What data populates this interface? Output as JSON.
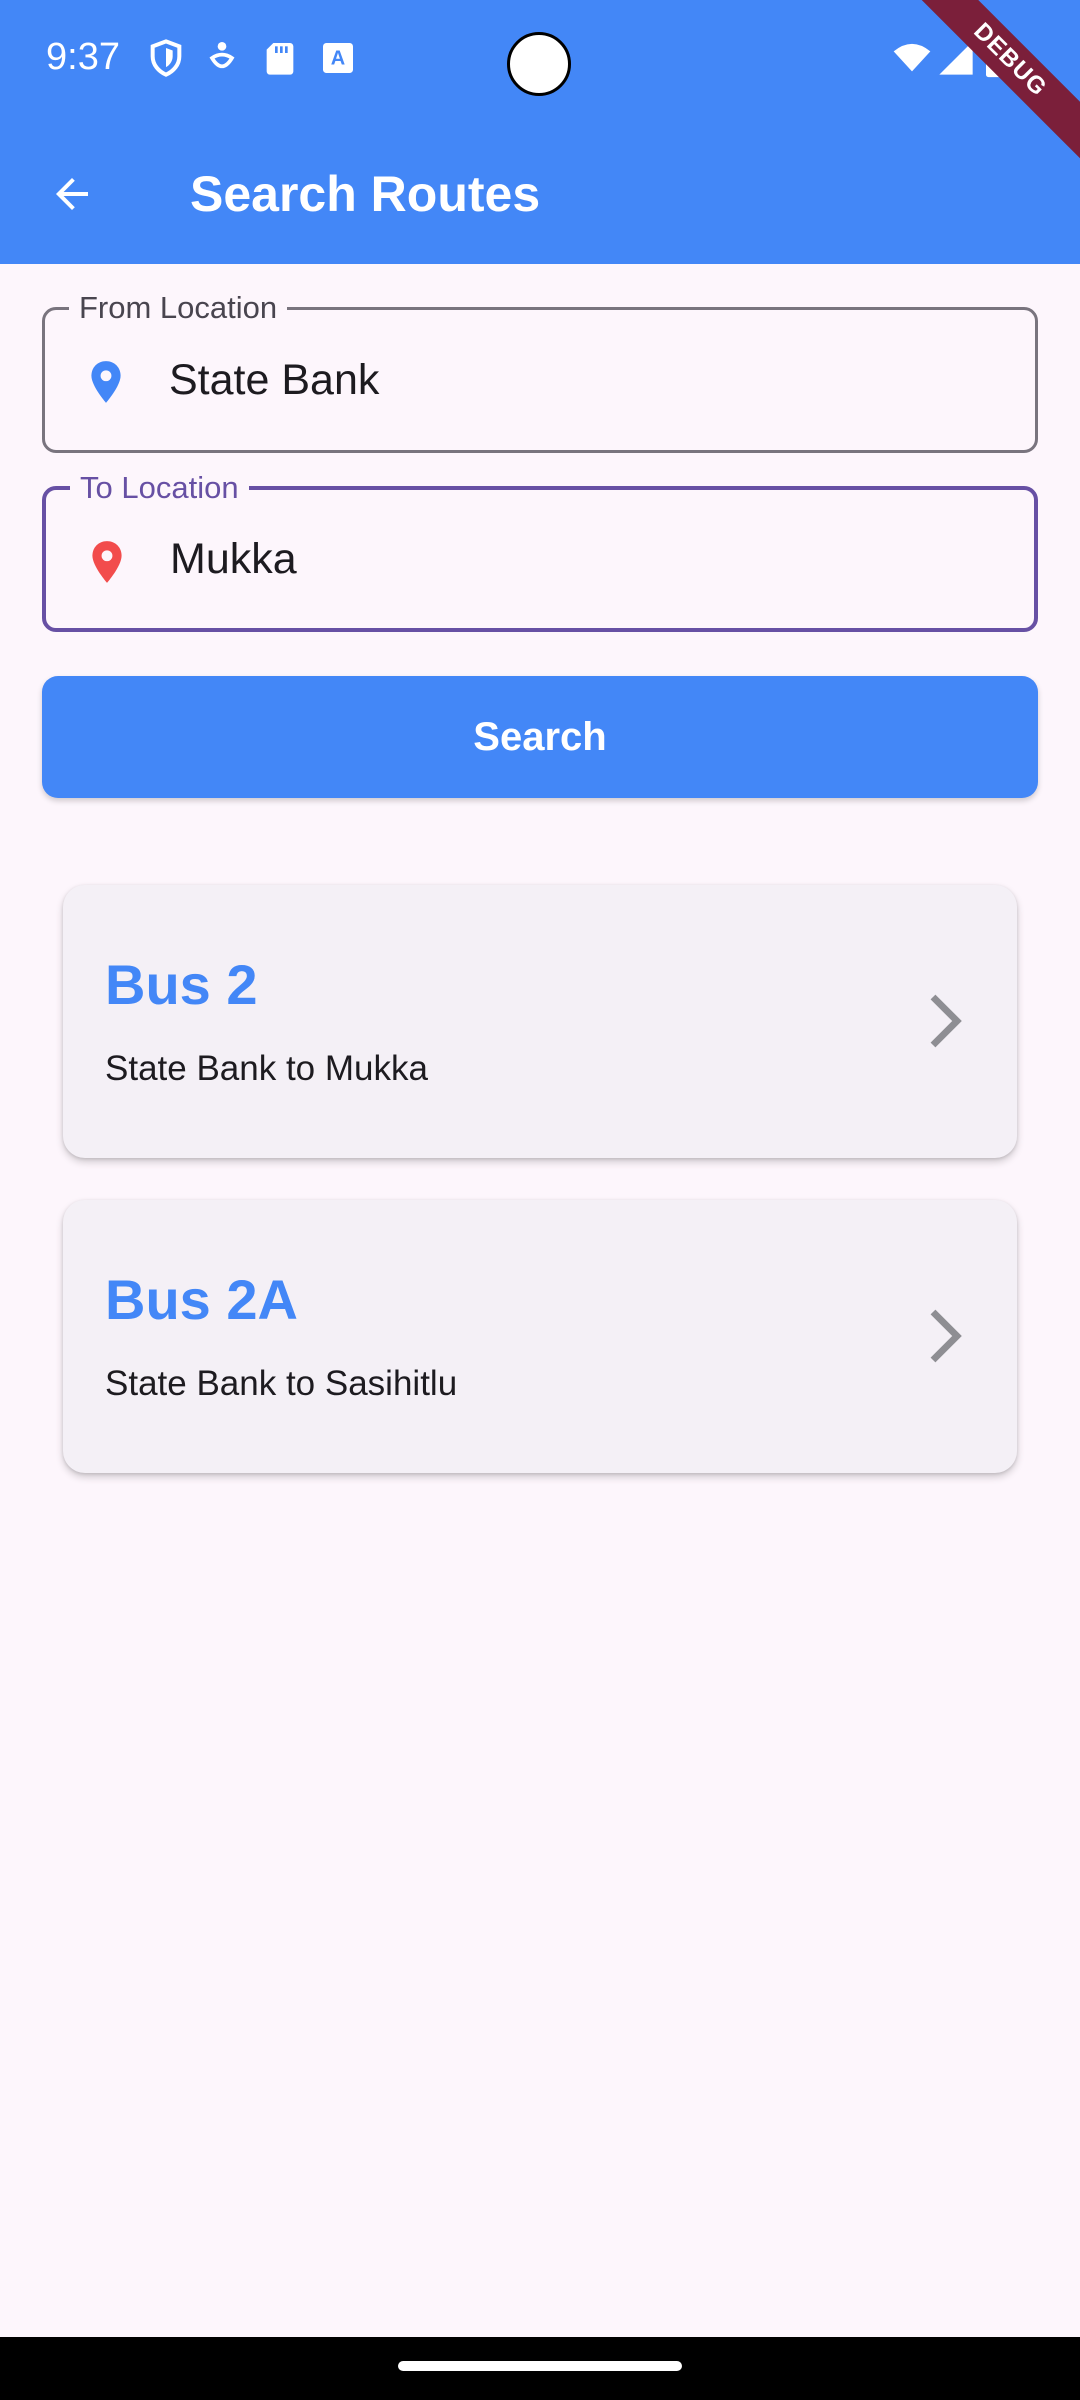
{
  "status_bar": {
    "time": "9:37",
    "icons": [
      "shield-icon",
      "accessibility-icon",
      "sd-card-icon",
      "keyboard-a-icon",
      "wifi-icon",
      "signal-icon",
      "battery-icon"
    ],
    "debug_banner": "DEBUG"
  },
  "app_bar": {
    "title": "Search Routes",
    "back_icon": "arrow-back-icon",
    "color": "#4387F7"
  },
  "form": {
    "from": {
      "label": "From Location",
      "value": "State Bank",
      "icon": "location-pin-icon",
      "icon_color": "#4387F7"
    },
    "to": {
      "label": "To Location",
      "value": "Mukka",
      "icon": "location-pin-icon",
      "icon_color": "#F24C4C",
      "focus_color": "#6750A4"
    },
    "search_label": "Search"
  },
  "routes": [
    {
      "name": "Bus 2",
      "description": "State Bank to Mukka"
    },
    {
      "name": "Bus 2A",
      "description": "State Bank to Sasihitlu"
    }
  ]
}
